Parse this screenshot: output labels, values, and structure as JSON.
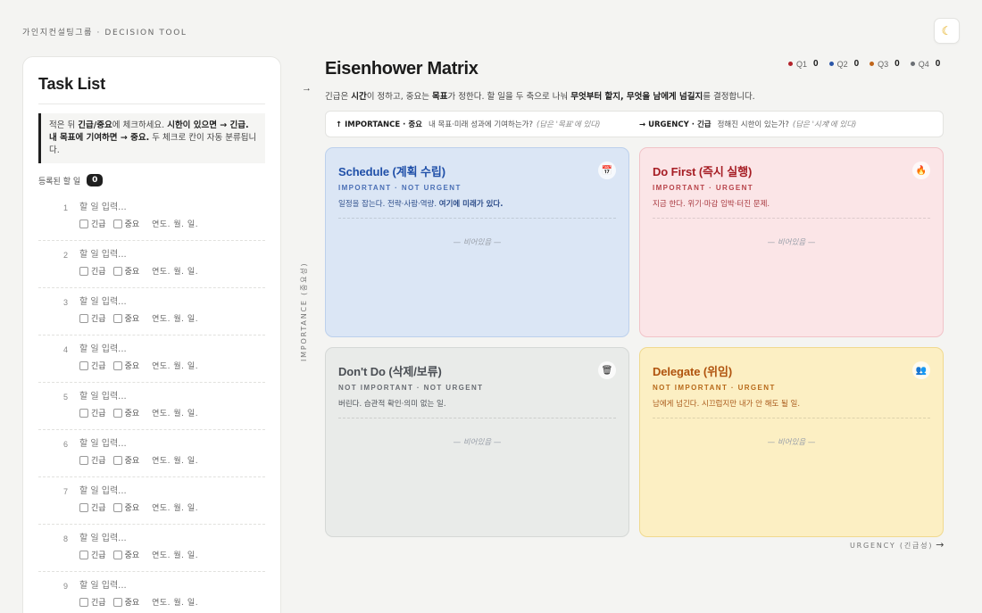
{
  "brand": "가인지컨설팅그룹 · DECISION TOOL",
  "theme_toggle_icon": "moon-icon",
  "task_panel": {
    "title": "Task List",
    "hint_parts": [
      "적은 뒤 ",
      "긴급/중요",
      "에 체크하세요. ",
      "시한이 있으면 → 긴급. 내 목표에 기여하면 → 중요.",
      " 두 체크로 칸이 자동 분류됩니다."
    ],
    "count_label": "등록된 할 일",
    "count": "0",
    "rows": [
      {
        "num": "1",
        "placeholder": "할 일 입력...",
        "urgent": "긴급",
        "important": "중요",
        "date": "연도. 월. 일."
      },
      {
        "num": "2",
        "placeholder": "할 일 입력...",
        "urgent": "긴급",
        "important": "중요",
        "date": "연도. 월. 일."
      },
      {
        "num": "3",
        "placeholder": "할 일 입력...",
        "urgent": "긴급",
        "important": "중요",
        "date": "연도. 월. 일."
      },
      {
        "num": "4",
        "placeholder": "할 일 입력...",
        "urgent": "긴급",
        "important": "중요",
        "date": "연도. 월. 일."
      },
      {
        "num": "5",
        "placeholder": "할 일 입력...",
        "urgent": "긴급",
        "important": "중요",
        "date": "연도. 월. 일."
      },
      {
        "num": "6",
        "placeholder": "할 일 입력...",
        "urgent": "긴급",
        "important": "중요",
        "date": "연도. 월. 일."
      },
      {
        "num": "7",
        "placeholder": "할 일 입력...",
        "urgent": "긴급",
        "important": "중요",
        "date": "연도. 월. 일."
      },
      {
        "num": "8",
        "placeholder": "할 일 입력...",
        "urgent": "긴급",
        "important": "중요",
        "date": "연도. 월. 일."
      },
      {
        "num": "9",
        "placeholder": "할 일 입력...",
        "urgent": "긴급",
        "important": "중요",
        "date": "연도. 월. 일."
      }
    ]
  },
  "matrix": {
    "title": "Eisenhower Matrix",
    "legend": [
      {
        "label": "Q1",
        "count": "0",
        "color": "#b3232b"
      },
      {
        "label": "Q2",
        "count": "0",
        "color": "#2b56a8"
      },
      {
        "label": "Q3",
        "count": "0",
        "color": "#c0651a"
      },
      {
        "label": "Q4",
        "count": "0",
        "color": "#6b6f75"
      }
    ],
    "desc_parts": [
      "긴급은 ",
      "시간",
      "이 정하고, 중요는 ",
      "목표",
      "가 정한다. 할 일을 두 축으로 나눠 ",
      "무엇부터 할지, 무엇을 남에게 넘길지",
      "를 결정합니다."
    ],
    "axis_importance": {
      "key": "↑ IMPORTANCE · 중요",
      "text": "내 목표·미래 성과에 기여하는가?",
      "q": "(답은 '목표'에 있다)"
    },
    "axis_urgency": {
      "key": "→ URGENCY · 긴급",
      "text": "정해진 시한이 있는가?",
      "q": "(답은 '시계'에 있다)"
    },
    "importance_axis_label": "IMPORTANCE (중요성)",
    "urgency_axis_label": "URGENCY (긴급성)",
    "quadrants": {
      "schedule": {
        "name": "Schedule (계획 수립)",
        "tag": "IMPORTANT · NOT URGENT",
        "desc_pre": "일정을 잡는다. 전략·사람·역량. ",
        "desc_bold": "여기에 미래가 있다.",
        "empty": "— 비어있음 —",
        "icon": "calendar-icon",
        "icon_glyph": "📅"
      },
      "dofirst": {
        "name": "Do First (즉시 실행)",
        "tag": "IMPORTANT · URGENT",
        "desc_pre": "지금 한다. 위기·마감 임박·터진 문제.",
        "desc_bold": "",
        "empty": "— 비어있음 —",
        "icon": "fire-icon",
        "icon_glyph": "🔥"
      },
      "dontdo": {
        "name": "Don't Do (삭제/보류)",
        "tag": "NOT IMPORTANT · NOT URGENT",
        "desc_pre": "버린다. 습관적 확인·의미 없는 일.",
        "desc_bold": "",
        "empty": "— 비어있음 —",
        "icon": "trash-icon",
        "icon_glyph": "🗑"
      },
      "delegate": {
        "name": "Delegate (위임)",
        "tag": "NOT IMPORTANT · URGENT",
        "desc_pre": "남에게 넘긴다. 시끄럽지만 내가 안 해도 될 일.",
        "desc_bold": "",
        "empty": "— 비어있음 —",
        "icon": "people-icon",
        "icon_glyph": "👥"
      }
    }
  }
}
